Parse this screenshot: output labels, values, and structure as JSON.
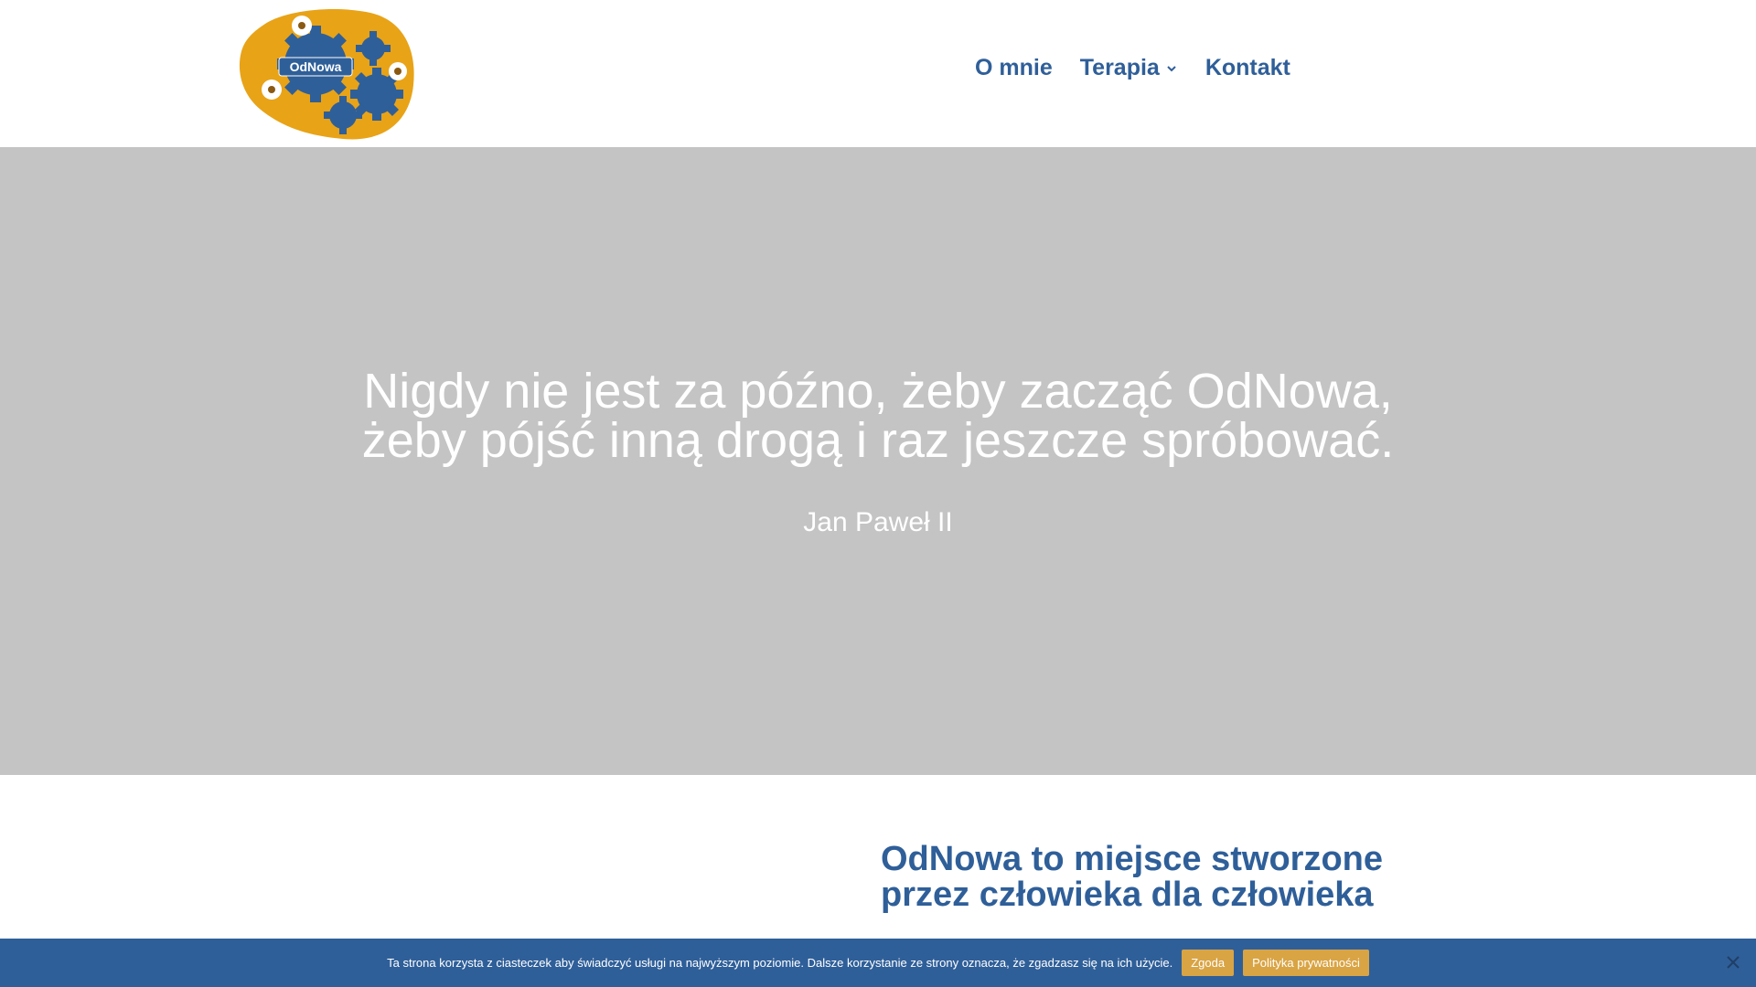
{
  "header": {
    "logo_text": "OdNowa",
    "nav": [
      {
        "label": "O mnie"
      },
      {
        "label": "Terapia",
        "has_submenu": true
      },
      {
        "label": "Kontakt"
      }
    ]
  },
  "hero": {
    "quote_lines": [
      "Nigdy nie jest za późno, żeby zacząć OdNowa,",
      "żeby pójść inną drogą i raz jeszcze spróbować."
    ],
    "author": "Jan Paweł II"
  },
  "content": {
    "heading_lines": [
      "OdNowa to miejsce stworzone",
      "przez człowieka dla człowieka"
    ]
  },
  "cookie_notice": {
    "text": "Ta strona korzysta z ciasteczek aby świadczyć usługi na najwyższym poziomie. Dalsze korzystanie ze strony oznacza, że zgadzasz się na ich użycie.",
    "accept_label": "Zgoda",
    "policy_label": "Polityka prywatności"
  },
  "colors": {
    "brand_blue": "#2f5f99",
    "accent_gold": "#d9a444",
    "logo_orange": "#e8a317",
    "hero_gray": "#c4c4c4"
  },
  "icons": {
    "submenu": "chevron-down-icon",
    "close": "close-icon",
    "logo": "gears-daisies-logo"
  }
}
